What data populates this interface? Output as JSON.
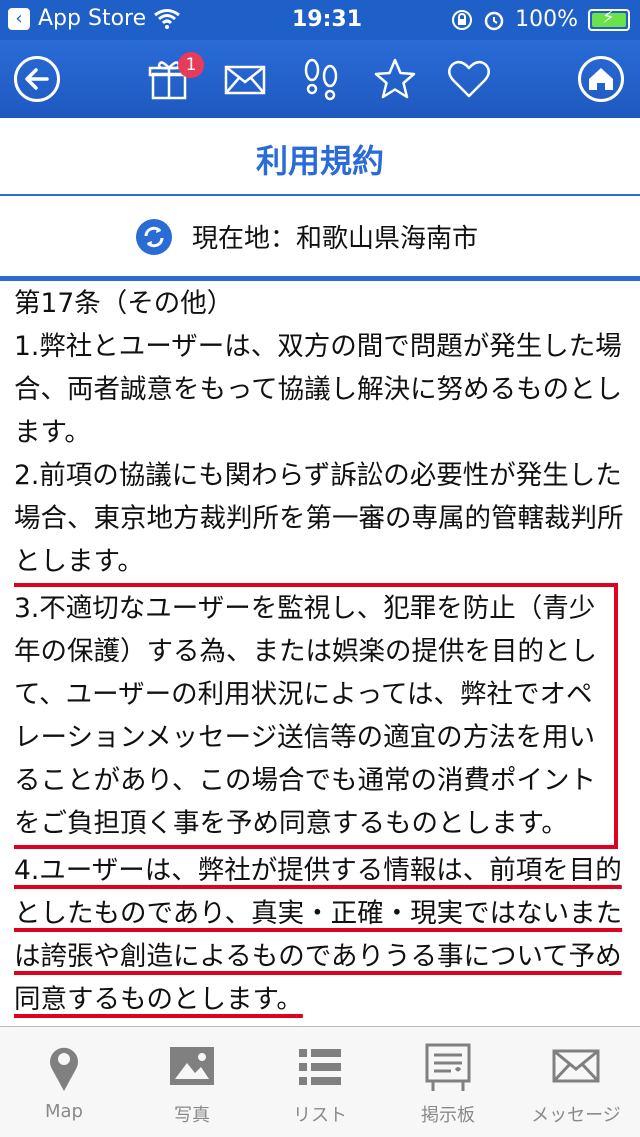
{
  "status": {
    "carrier": "App Store",
    "time": "19:31",
    "battery": "100%"
  },
  "nav": {
    "badge_count": "1"
  },
  "header": {
    "title": "利用規約"
  },
  "location": {
    "text": "現在地：和歌山県海南市"
  },
  "content": {
    "heading": "第17条（その他）",
    "p1": "1.弊社とユーザーは、双方の間で問題が発生した場合、両者誠意をもって協議し解決に努めるものとします。",
    "p2": "2.前項の協議にも関わらず訴訟の必要性が発生した場合、東京地方裁判所を第一審の専属的管轄裁判所とします。",
    "p3": "3.不適切なユーザーを監視し、犯罪を防止（青少年の保護）する為、または娯楽の提供を目的として、ユーザーの利用状況によっては、弊社でオペレーションメッセージ送信等の適宜の方法を用いることがあり、この場合でも通常の消費ポイントをご負担頂く事を予め同意するものとします。",
    "p4": "4.ユーザーは、弊社が提供する情報は、前項を目的としたものであり、真実・正確・現実ではないまたは誇張や創造によるものでありうる事について予め同意するものとします。"
  },
  "tabs": [
    {
      "label": "Map"
    },
    {
      "label": "写真"
    },
    {
      "label": "リスト"
    },
    {
      "label": "掲示板"
    },
    {
      "label": "メッセージ"
    }
  ],
  "colors": {
    "primary": "#2a6bd6",
    "highlight": "#e00020",
    "badge": "#e63c5a"
  }
}
